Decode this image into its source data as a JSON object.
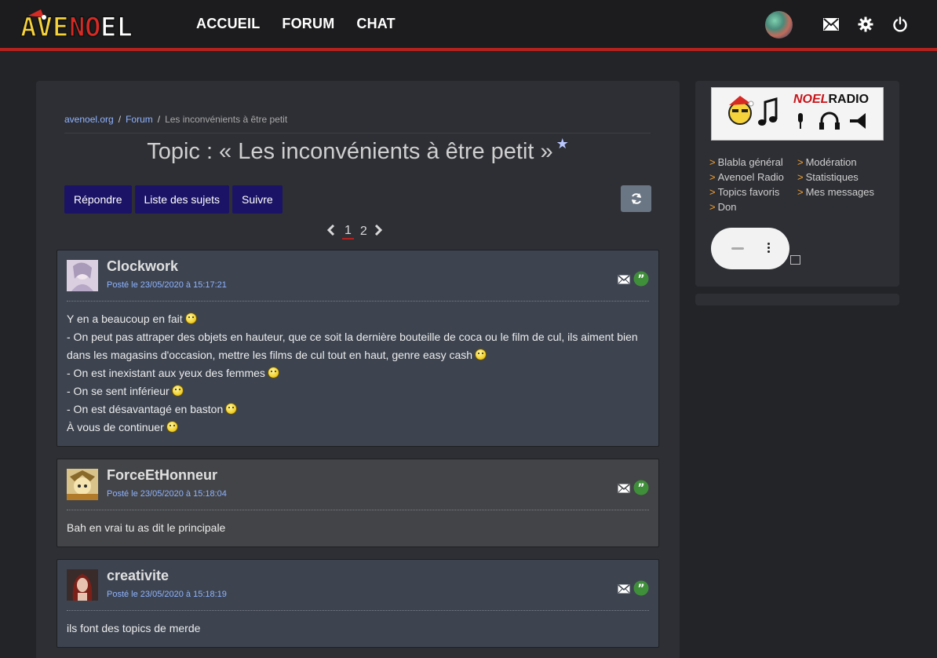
{
  "header": {
    "logo_text": "AVENOEL",
    "nav": [
      "ACCUEIL",
      "FORUM",
      "CHAT"
    ]
  },
  "breadcrumb": {
    "items": [
      "avenoel.org",
      "Forum"
    ],
    "current": "Les inconvénients à être petit"
  },
  "topic": {
    "title": "Topic : « Les inconvénients à être petit »"
  },
  "actions": [
    "Répondre",
    "Liste des sujets",
    "Suivre"
  ],
  "pagination": {
    "pages": [
      "1",
      "2"
    ],
    "current": "1"
  },
  "posts": [
    {
      "author": "Clockwork",
      "date": "Posté le 23/05/2020 à 15:17:21",
      "lines": [
        "Y en a beaucoup en fait",
        "- On peut pas attraper des objets en hauteur, que ce soit la dernière bouteille de coca ou le film de cul, ils aiment bien dans les magasins d'occasion, mettre les films de cul tout en haut, genre easy cash",
        "- On est inexistant aux yeux des femmes",
        "- On se sent inférieur",
        "- On est désavantagé en baston",
        "À vous de continuer"
      ]
    },
    {
      "author": "ForceEtHonneur",
      "date": "Posté le 23/05/2020 à 15:18:04",
      "lines": [
        "Bah en vrai tu as dit le principale"
      ]
    },
    {
      "author": "creativite",
      "date": "Posté le 23/05/2020 à 15:18:19",
      "lines": [
        "ils font des topics de merde"
      ]
    }
  ],
  "sidebar": {
    "radio_banner": {
      "brand_red": "NOEL",
      "brand_black": "RADIO"
    },
    "links": [
      "Blabla général",
      "Modération",
      "Avenoel Radio",
      "Statistiques",
      "Topics favoris",
      "Mes messages",
      "Don"
    ]
  },
  "colors": {
    "accent_red": "#b3221f",
    "button_navy": "#1b1466",
    "link_blue": "#8fb3ff",
    "bullet_orange": "#f0a030"
  }
}
